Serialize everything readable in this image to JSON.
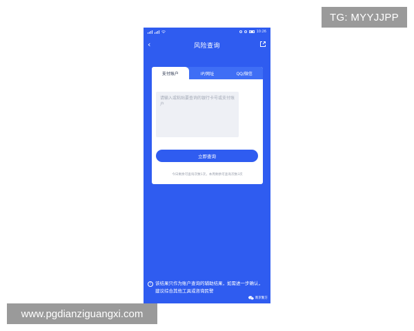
{
  "watermarks": {
    "tg_handle": "TG: MYYJJPP",
    "site_url": "www.pgdianziguangxi.com"
  },
  "statusbar": {
    "time": "10:26"
  },
  "navbar": {
    "back_icon": "chevron-left-icon",
    "title": "风险查询",
    "share_icon": "share-icon"
  },
  "tabs": [
    {
      "label": "支付账户",
      "active": true
    },
    {
      "label": "IP/网址",
      "active": false
    },
    {
      "label": "QQ/微信",
      "active": false
    }
  ],
  "search": {
    "placeholder": "请输入或粘贴要查询的银行卡号或支付账户"
  },
  "query_button": {
    "label": "立即查询"
  },
  "remaining_text": "今日剩余可查询次数1次，本周剩余可查询次数3次",
  "footer": {
    "note": "该结果只作为账户查询的辅助结果，如需进一步确认，建议综合其他工具或咨询民警",
    "source": "南京警方"
  },
  "colors": {
    "primary_blue": "#2f5cf0",
    "tab_bar_blue": "#3f6ef5",
    "input_bg": "#eef0f5"
  }
}
